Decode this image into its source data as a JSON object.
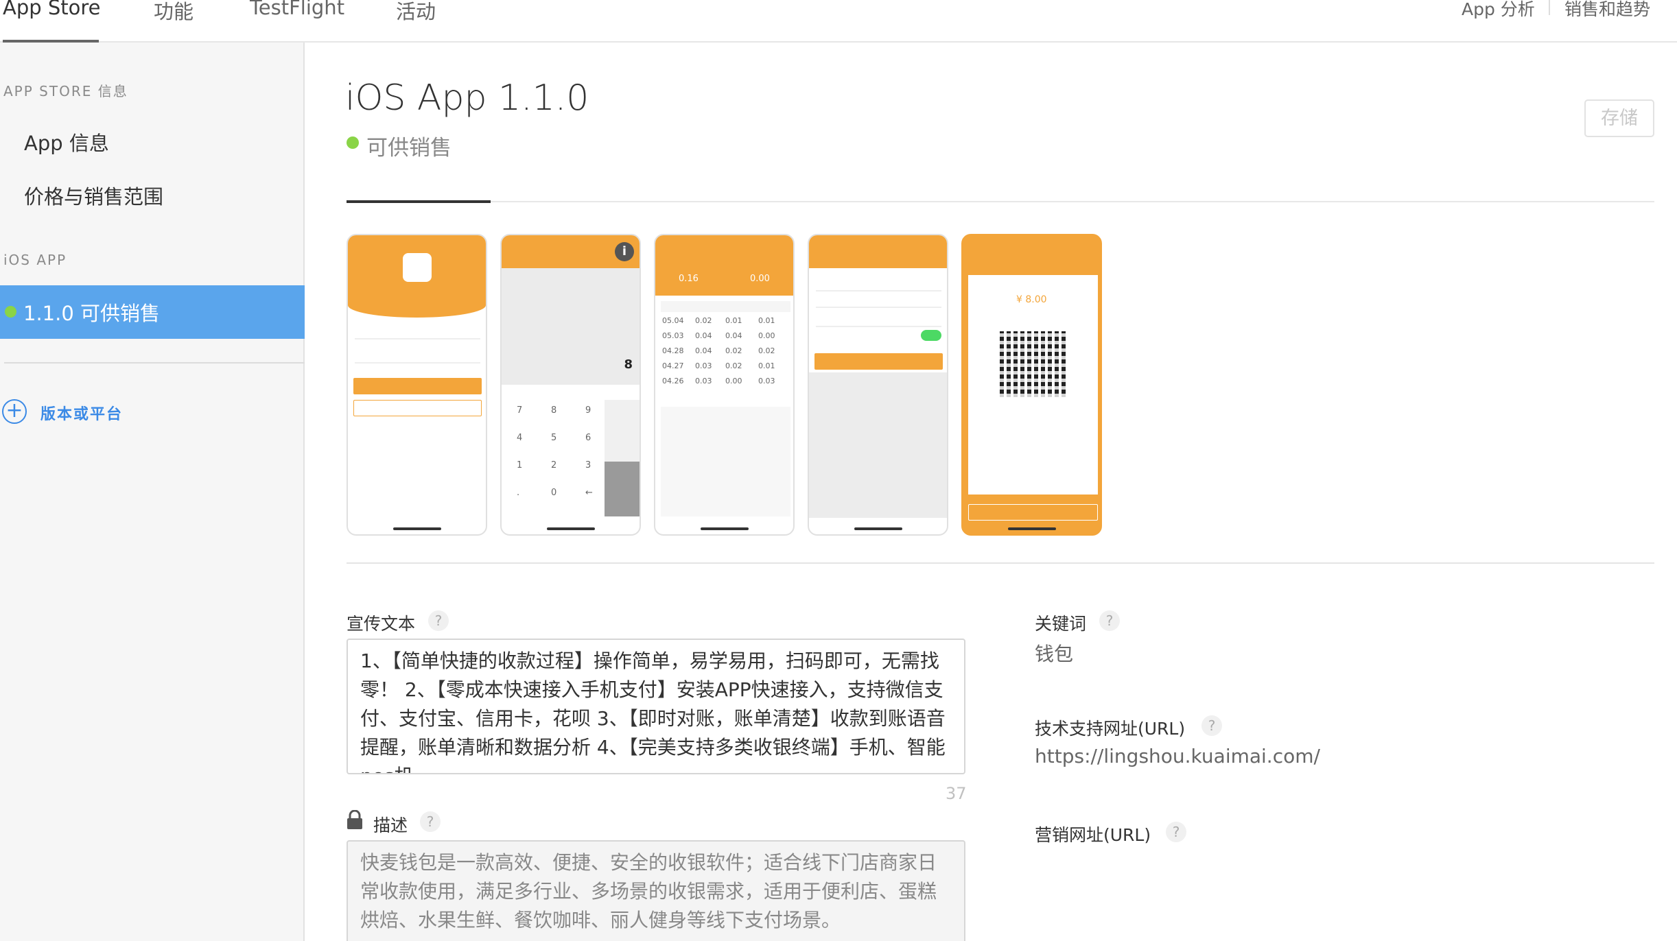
{
  "top_nav": {
    "tabs": [
      "App Store",
      "功能",
      "TestFlight",
      "活动"
    ],
    "right_links": [
      "App 分析",
      "销售和趋势"
    ]
  },
  "sidebar": {
    "section_store": "APP STORE 信息",
    "store_items": [
      "App 信息",
      "价格与销售范围"
    ],
    "section_ios": "iOS APP",
    "selected_version": "1.1.0 可供销售",
    "add_version": "版本或平台"
  },
  "header": {
    "title": "iOS App 1.1.0",
    "status": "可供销售",
    "save_label": "存储"
  },
  "screenshots": {
    "count": 5,
    "shot2_keypad": [
      "7",
      "8",
      "9",
      "4",
      "5",
      "6",
      "1",
      "2",
      "3",
      ".",
      "0",
      "←"
    ],
    "shot2_amount": "8",
    "shot3_stats": [
      "0.16",
      "0.00"
    ],
    "shot3_rows": [
      [
        "05.04",
        "0.02",
        "0.01",
        "0.01"
      ],
      [
        "05.03",
        "0.04",
        "0.04",
        "0.00"
      ],
      [
        "04.28",
        "0.04",
        "0.02",
        "0.02"
      ],
      [
        "04.27",
        "0.03",
        "0.02",
        "0.01"
      ],
      [
        "04.26",
        "0.03",
        "0.00",
        "0.03"
      ]
    ],
    "shot5_amount": "¥ 8.00"
  },
  "promo": {
    "label": "宣传文本",
    "text": "1、【简单快捷的收款过程】操作简单，易学易用，扫码即可，无需找零！ 2、【零成本快速接入手机支付】安装APP快速接入，支持微信支付、支付宝、信用卡，花呗 3、【即时对账，账单清楚】收款到账语音提醒，账单清晰和数据分析 4、【完美支持多类收银终端】手机、智能pos机",
    "counter": "37"
  },
  "description": {
    "label": "描述",
    "text": "快麦钱包是一款高效、便捷、安全的收银软件；适合线下门店商家日常收款使用，满足多行业、多场景的收银需求，适用于便利店、蛋糕烘焙、水果生鲜、餐饮咖啡、丽人健身等线下支付场景。"
  },
  "keywords": {
    "label": "关键词",
    "value": "钱包"
  },
  "support_url": {
    "label": "技术支持网址(URL)",
    "value": "https://lingshou.kuaimai.com/"
  },
  "marketing_url": {
    "label": "营销网址(URL)"
  },
  "help_glyph": "?",
  "colors": {
    "accent": "#f3a53a",
    "selected": "#5aa5ec",
    "status_green": "#8ad447",
    "link_blue": "#3b8ae6"
  }
}
